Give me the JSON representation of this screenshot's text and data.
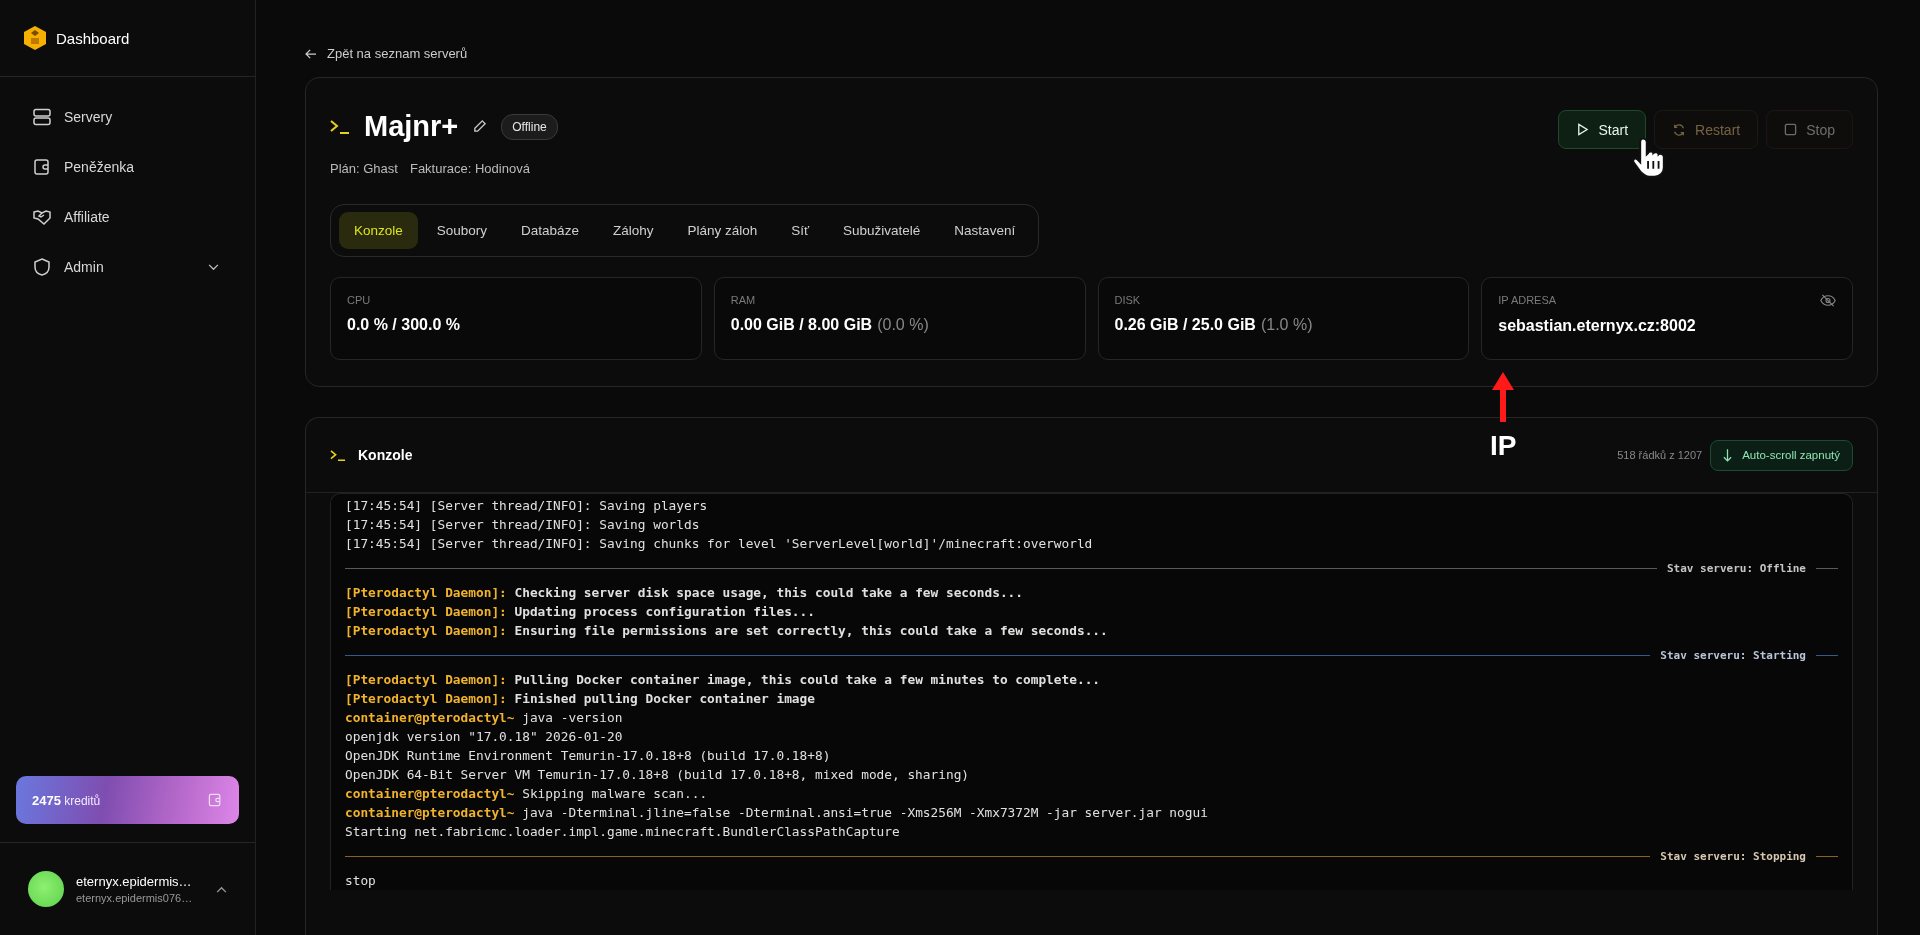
{
  "sidebar": {
    "brand": "Dashboard",
    "items": [
      {
        "label": "Servery",
        "selected": false
      },
      {
        "label": "Peněženka",
        "selected": false
      },
      {
        "label": "Affiliate",
        "selected": false
      },
      {
        "label": "Admin",
        "selected": false,
        "expanded": false
      }
    ],
    "credits": {
      "amount": "2475",
      "unit": "kreditů"
    },
    "user": {
      "name": "eternyx.epidermis…",
      "email": "eternyx.epidermis076…"
    }
  },
  "back_link": "Zpět na seznam serverů",
  "server": {
    "name": "Majnr+",
    "status": "Offline",
    "plan": "Plán: Ghast",
    "billing": "Fakturace: Hodinová",
    "actions": [
      {
        "label": "Start",
        "kind": "start",
        "disabled": false
      },
      {
        "label": "Restart",
        "kind": "restart",
        "disabled": true
      },
      {
        "label": "Stop",
        "kind": "stop",
        "disabled": true
      }
    ],
    "tabs": [
      {
        "label": "Konzole",
        "selected": true
      },
      {
        "label": "Soubory",
        "selected": false
      },
      {
        "label": "Databáze",
        "selected": false
      },
      {
        "label": "Zálohy",
        "selected": false
      },
      {
        "label": "Plány záloh",
        "selected": false
      },
      {
        "label": "Síť",
        "selected": false
      },
      {
        "label": "Subuživatelé",
        "selected": false
      },
      {
        "label": "Nastavení",
        "selected": false
      }
    ],
    "stats": [
      {
        "label": "CPU",
        "value": "0.0 % / 300.0 %"
      },
      {
        "label": "RAM",
        "value": "0.00 GiB / 8.00 GiB",
        "percent": "(0.0 %)"
      },
      {
        "label": "DISK",
        "value": "0.26 GiB / 25.0 GiB",
        "percent": "(1.0 %)"
      },
      {
        "label": "IP ADRESA",
        "value": "sebastian.eternyx.cz:8002",
        "hide_toggle": true
      }
    ]
  },
  "console": {
    "title": "Konzole",
    "line_count": "518 řádků z 1207",
    "autoscroll": {
      "label": "Auto-scroll zapnutý",
      "on": true
    },
    "lines": [
      {
        "kind": "log",
        "text": "[17:45:54] [Server thread/INFO]: Saving players"
      },
      {
        "kind": "log",
        "text": "[17:45:54] [Server thread/INFO]: Saving worlds"
      },
      {
        "kind": "log",
        "text": "[17:45:54] [Server thread/INFO]: Saving chunks for level 'ServerLevel[world]'/minecraft:overworld"
      },
      {
        "kind": "divider",
        "text": "Stav serveru: Offline",
        "color": "#5a5a5a"
      },
      {
        "kind": "daemon",
        "prefix": "[Pterodactyl Daemon]:",
        "text": "Checking server disk space usage, this could take a few seconds..."
      },
      {
        "kind": "daemon",
        "prefix": "[Pterodactyl Daemon]:",
        "text": "Updating process configuration files..."
      },
      {
        "kind": "daemon",
        "prefix": "[Pterodactyl Daemon]:",
        "text": "Ensuring file permissions are set correctly, this could take a few seconds..."
      },
      {
        "kind": "divider",
        "text": "Stav serveru: Starting",
        "color": "#34598f"
      },
      {
        "kind": "daemon",
        "prefix": "[Pterodactyl Daemon]:",
        "text": "Pulling Docker container image, this could take a few minutes to complete..."
      },
      {
        "kind": "daemon",
        "prefix": "[Pterodactyl Daemon]:",
        "text": "Finished pulling Docker container image"
      },
      {
        "kind": "prompt",
        "prefix": "container@pterodactyl~",
        "text": "java -version"
      },
      {
        "kind": "log",
        "text": "openjdk version \"17.0.18\" 2026-01-20"
      },
      {
        "kind": "log",
        "text": "OpenJDK Runtime Environment Temurin-17.0.18+8 (build 17.0.18+8)"
      },
      {
        "kind": "log",
        "text": "OpenJDK 64-Bit Server VM Temurin-17.0.18+8 (build 17.0.18+8, mixed mode, sharing)"
      },
      {
        "kind": "prompt",
        "prefix": "container@pterodactyl~",
        "text": "Skipping malware scan..."
      },
      {
        "kind": "prompt",
        "prefix": "container@pterodactyl~",
        "text": "java -Dterminal.jline=false -Dterminal.ansi=true -Xms256M -Xmx7372M -jar server.jar nogui"
      },
      {
        "kind": "log",
        "text": "Starting net.fabricmc.loader.impl.game.minecraft.BundlerClassPathCapture"
      },
      {
        "kind": "divider",
        "text": "Stav serveru: Stopping",
        "color": "#8a6224"
      },
      {
        "kind": "log",
        "text": "stop"
      }
    ]
  },
  "annotation": {
    "label": "IP"
  }
}
